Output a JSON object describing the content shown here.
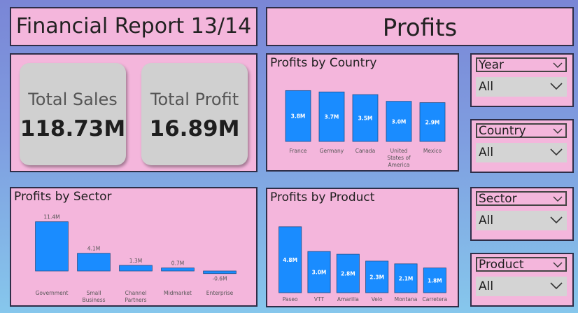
{
  "header": {
    "report_title": "Financial Report 13/14",
    "page_title": "Profits"
  },
  "kpis": [
    {
      "label": "Total Sales",
      "value": "118.73M"
    },
    {
      "label": "Total Profit",
      "value": "16.89M"
    }
  ],
  "charts": {
    "country": {
      "title": "Profits by Country",
      "bar_color": "#1a8cff"
    },
    "sector": {
      "title": "Profits by Sector",
      "bar_color": "#1a8cff"
    },
    "product": {
      "title": "Profits by Product",
      "bar_color": "#1a8cff"
    }
  },
  "chart_data": [
    {
      "type": "bar",
      "title": "Profits by Country",
      "categories": [
        "France",
        "Germany",
        "Canada",
        "United States of America",
        "Mexico"
      ],
      "values": [
        3.8,
        3.7,
        3.5,
        3.0,
        2.9
      ],
      "data_labels": [
        "3.8M",
        "3.7M",
        "3.5M",
        "3.0M",
        "2.9M"
      ],
      "label_position": "inside",
      "ylim": [
        0,
        4.5
      ]
    },
    {
      "type": "bar",
      "title": "Profits by Sector",
      "categories": [
        "Government",
        "Small Business",
        "Channel Partners",
        "Midmarket",
        "Enterprise"
      ],
      "values": [
        11.4,
        4.1,
        1.3,
        0.7,
        -0.6
      ],
      "data_labels": [
        "11.4M",
        "4.1M",
        "1.3M",
        "0.7M",
        "-0.6M"
      ],
      "label_position": "outside",
      "ylim": [
        -1,
        12
      ]
    },
    {
      "type": "bar",
      "title": "Profits by Product",
      "categories": [
        "Paseo",
        "VTT",
        "Amarilla",
        "Velo",
        "Montana",
        "Carretera"
      ],
      "values": [
        4.8,
        3.0,
        2.8,
        2.3,
        2.1,
        1.8
      ],
      "data_labels": [
        "4.8M",
        "3.0M",
        "2.8M",
        "2.3M",
        "2.1M",
        "1.8M"
      ],
      "label_position": "inside",
      "ylim": [
        0,
        5.2
      ]
    }
  ],
  "slicers": [
    {
      "name": "Year",
      "value": "All"
    },
    {
      "name": "Country",
      "value": "All"
    },
    {
      "name": "Sector",
      "value": "All"
    },
    {
      "name": "Product",
      "value": "All"
    }
  ]
}
